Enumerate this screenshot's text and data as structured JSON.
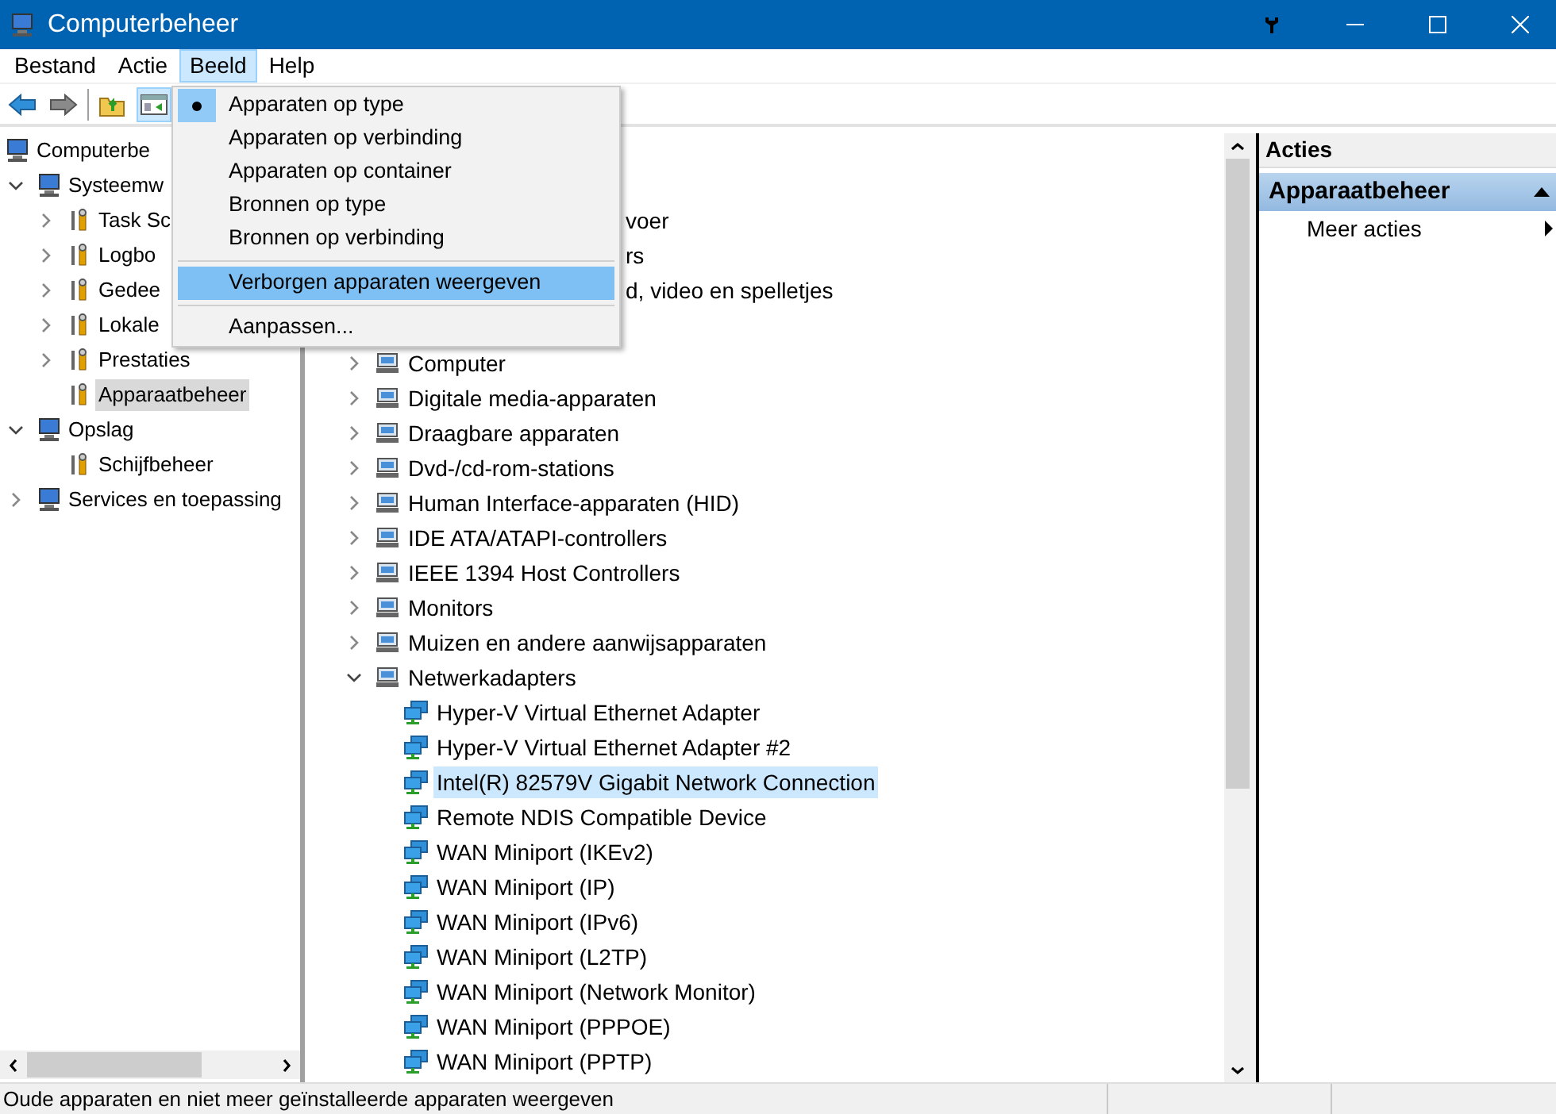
{
  "window": {
    "title": "Computerbeheer"
  },
  "menubar": [
    {
      "label": "Bestand",
      "selected": false
    },
    {
      "label": "Actie",
      "selected": false
    },
    {
      "label": "Beeld",
      "selected": true
    },
    {
      "label": "Help",
      "selected": false
    }
  ],
  "open_menu": {
    "items": [
      {
        "kind": "radio",
        "label": "Apparaten op type",
        "checked": true,
        "selected": false
      },
      {
        "kind": "radio",
        "label": "Apparaten op verbinding",
        "checked": false,
        "selected": false
      },
      {
        "kind": "radio",
        "label": "Apparaten op container",
        "checked": false,
        "selected": false
      },
      {
        "kind": "radio",
        "label": "Bronnen op type",
        "checked": false,
        "selected": false
      },
      {
        "kind": "radio",
        "label": "Bronnen op verbinding",
        "checked": false,
        "selected": false
      },
      {
        "kind": "separator"
      },
      {
        "kind": "command",
        "label": "Verborgen apparaten weergeven",
        "selected": true
      },
      {
        "kind": "separator"
      },
      {
        "kind": "command",
        "label": "Aanpassen...",
        "selected": false
      }
    ]
  },
  "console_tree": [
    {
      "label": "Computerbe",
      "selected": false,
      "children": [
        {
          "label": "Systeemw",
          "expanded": true,
          "selected": false,
          "children": [
            {
              "label": "Task Sc",
              "expanded": false,
              "selected": false
            },
            {
              "label": "Logbo",
              "expanded": false,
              "selected": false
            },
            {
              "label": "Gedee",
              "expanded": false,
              "selected": false
            },
            {
              "label": "Lokale",
              "expanded": false,
              "selected": false
            },
            {
              "label": "Prestaties",
              "expanded": false,
              "selected": false
            },
            {
              "label": "Apparaatbeheer",
              "selected": true
            }
          ]
        },
        {
          "label": "Opslag",
          "expanded": true,
          "selected": false,
          "children": [
            {
              "label": "Schijfbeheer",
              "selected": false
            }
          ]
        },
        {
          "label": "Services en toepassing",
          "expanded": false,
          "selected": false
        }
      ]
    }
  ],
  "device_tree": [
    {
      "kind": "covered",
      "label": "voer"
    },
    {
      "kind": "covered",
      "label": "rs"
    },
    {
      "kind": "covered",
      "label": "d, video en spelletjes"
    },
    {
      "kind": "category",
      "label": "Computer",
      "expanded": false
    },
    {
      "kind": "category",
      "label": "Digitale media-apparaten",
      "expanded": false
    },
    {
      "kind": "category",
      "label": "Draagbare apparaten",
      "expanded": false
    },
    {
      "kind": "category",
      "label": "Dvd-/cd-rom-stations",
      "expanded": false
    },
    {
      "kind": "category",
      "label": "Human Interface-apparaten (HID)",
      "expanded": false
    },
    {
      "kind": "category",
      "label": "IDE ATA/ATAPI-controllers",
      "expanded": false
    },
    {
      "kind": "category",
      "label": "IEEE 1394 Host Controllers",
      "expanded": false
    },
    {
      "kind": "category",
      "label": "Monitors",
      "expanded": false
    },
    {
      "kind": "category",
      "label": "Muizen en andere aanwijsapparaten",
      "expanded": false
    },
    {
      "kind": "category",
      "label": "Netwerkadapters",
      "expanded": true,
      "children": [
        {
          "label": "Hyper-V Virtual Ethernet Adapter",
          "selected": false
        },
        {
          "label": "Hyper-V Virtual Ethernet Adapter #2",
          "selected": false
        },
        {
          "label": "Intel(R) 82579V Gigabit Network Connection",
          "selected": true
        },
        {
          "label": "Remote NDIS Compatible Device",
          "selected": false
        },
        {
          "label": "WAN Miniport (IKEv2)",
          "selected": false
        },
        {
          "label": "WAN Miniport (IP)",
          "selected": false
        },
        {
          "label": "WAN Miniport (IPv6)",
          "selected": false
        },
        {
          "label": "WAN Miniport (L2TP)",
          "selected": false
        },
        {
          "label": "WAN Miniport (Network Monitor)",
          "selected": false
        },
        {
          "label": "WAN Miniport (PPPOE)",
          "selected": false
        },
        {
          "label": "WAN Miniport (PPTP)",
          "selected": false
        }
      ]
    }
  ],
  "actions_pane": {
    "header": "Acties",
    "section": "Apparaatbeheer",
    "items": [
      "Meer acties"
    ]
  },
  "status_bar": "Oude apparaten en niet meer geïnstalleerde apparaten weergeven"
}
